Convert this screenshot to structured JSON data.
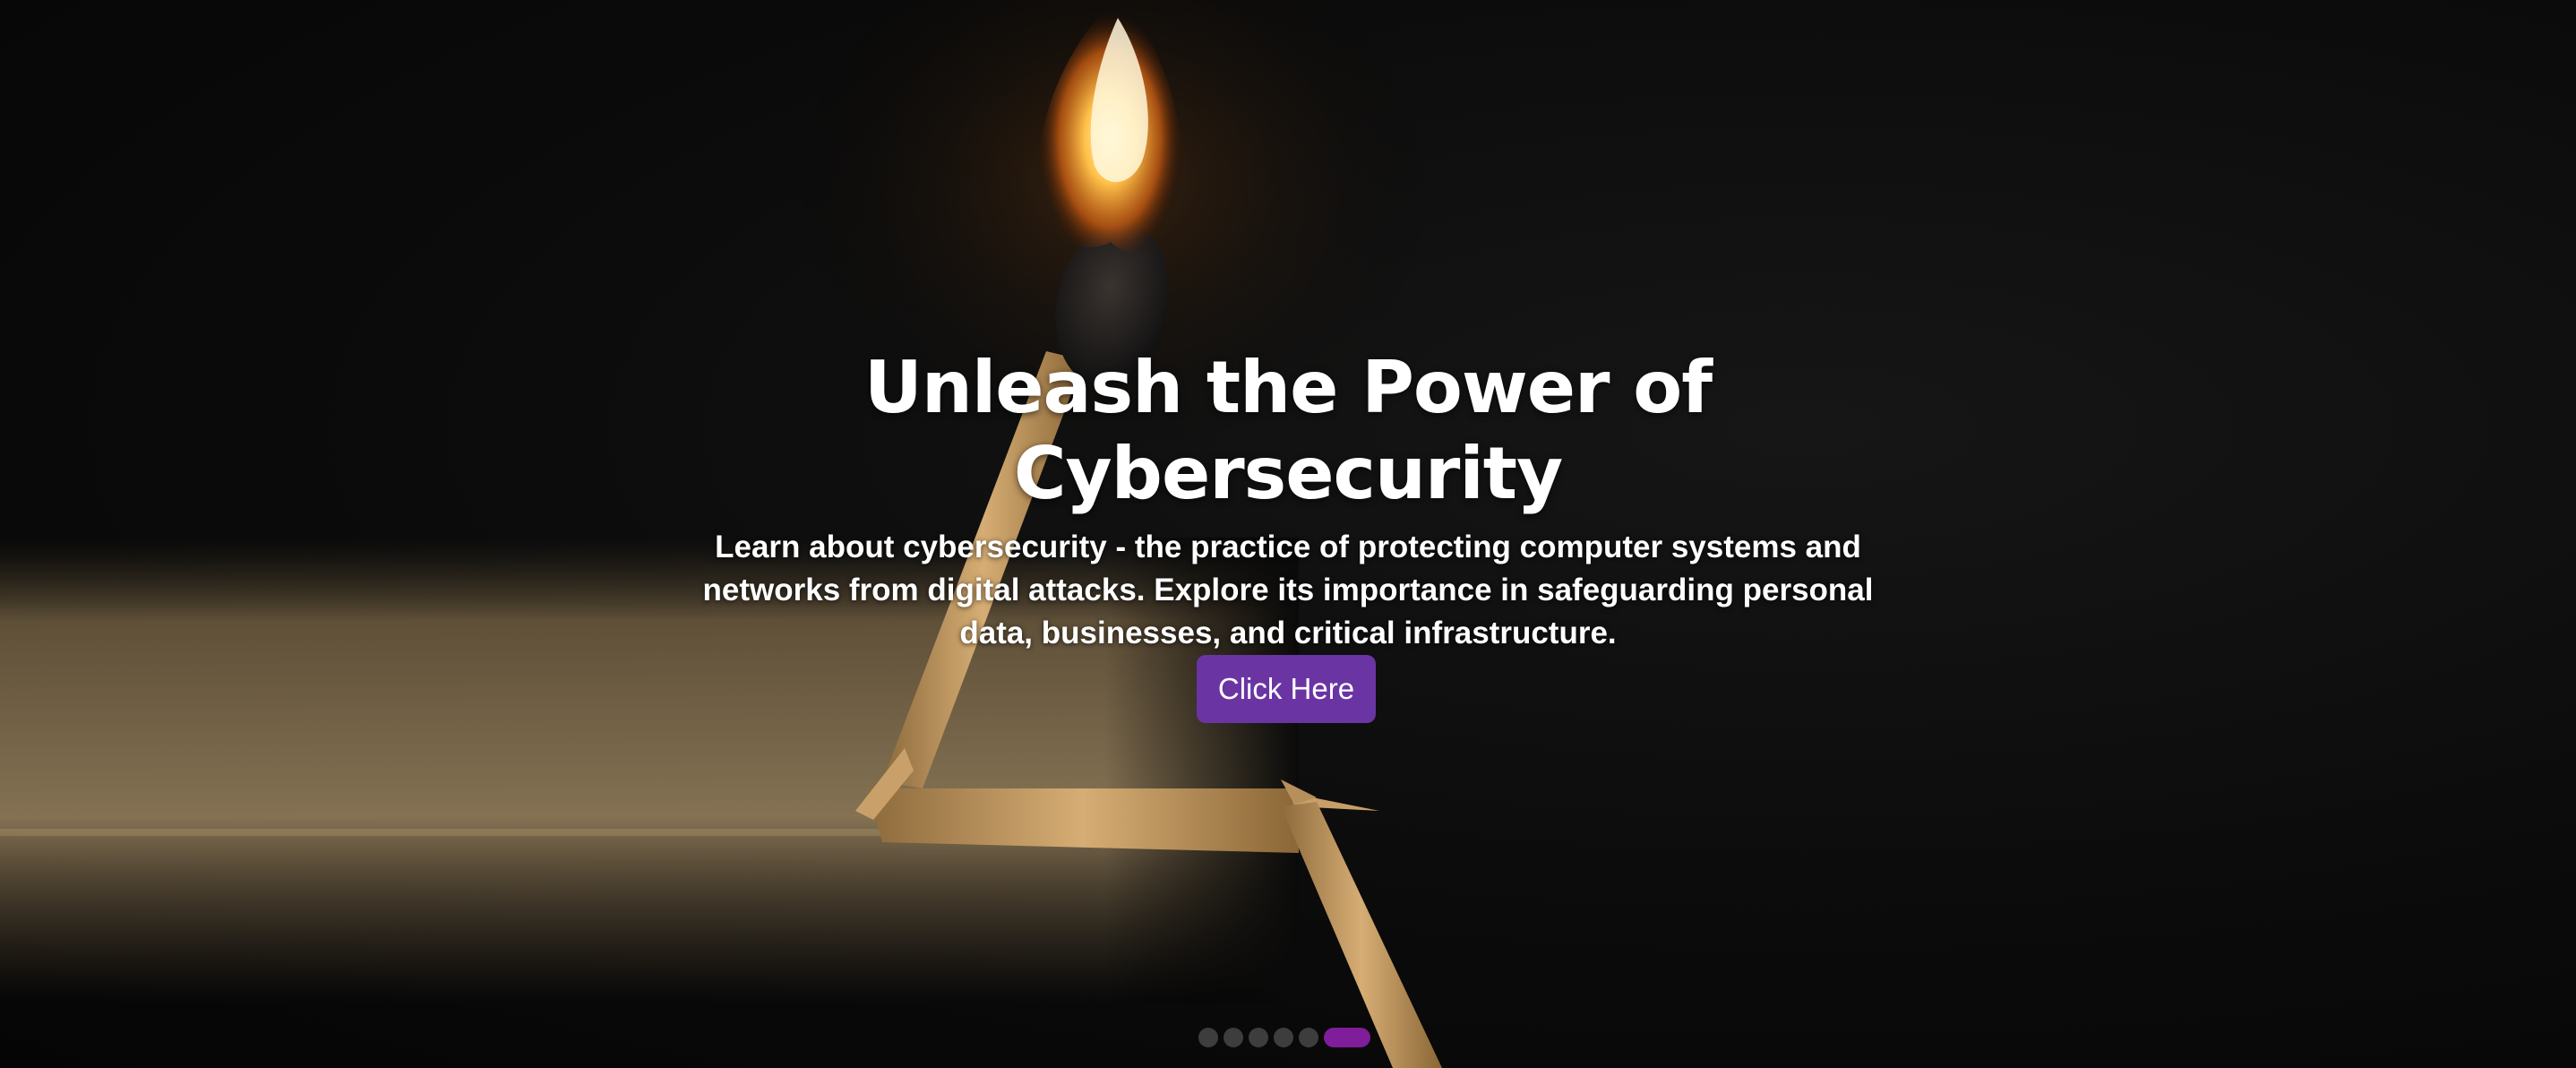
{
  "hero": {
    "title": "Unleash the Power of Cybersecurity",
    "description": "Learn about cybersecurity - the practice of protecting computer systems and networks from digital attacks. Explore its importance in safeguarding personal data, businesses, and critical infrastructure.",
    "cta_label": "Click Here",
    "background_image": "burning-match-icon"
  },
  "carousel": {
    "total_slides": 6,
    "active_slide": 6
  },
  "colors": {
    "accent": "#6a35a3",
    "active_indicator": "#7f1d9a",
    "inactive_indicator": "#3d3d3d",
    "text": "#ffffff"
  }
}
